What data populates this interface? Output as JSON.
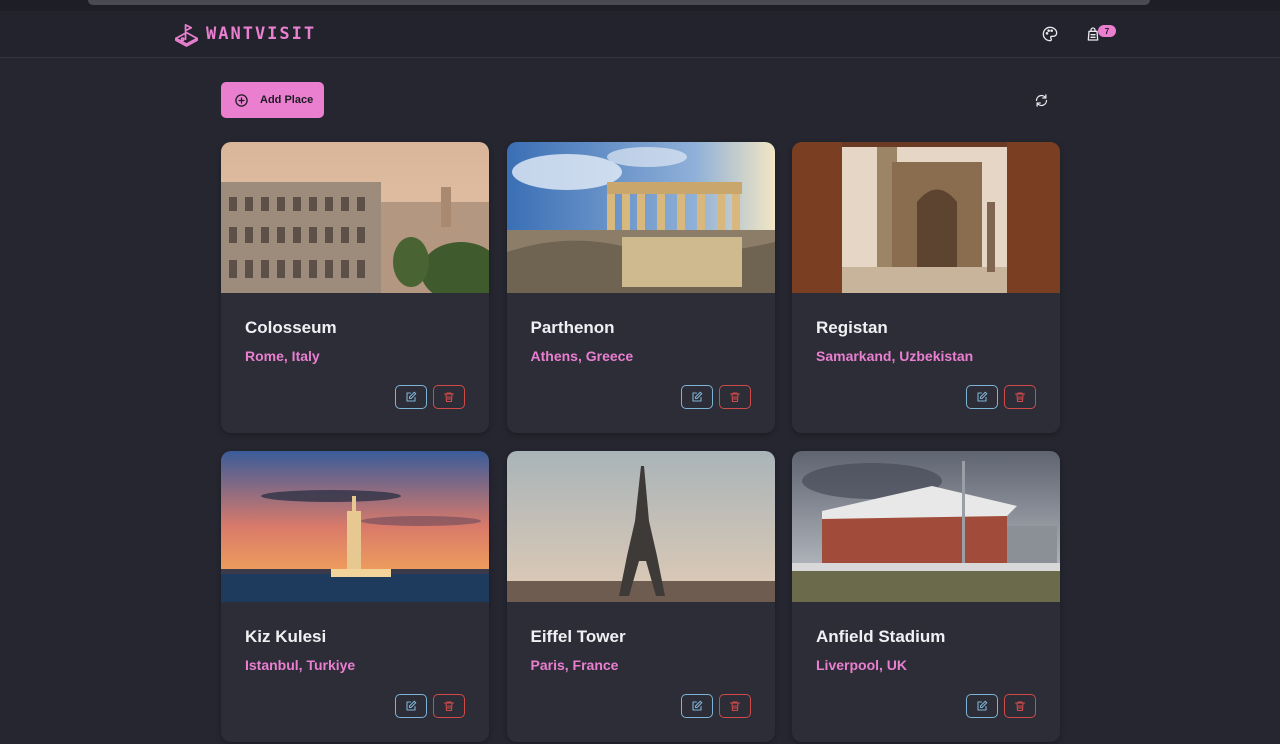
{
  "app": {
    "brand": "WANTVISIT",
    "cart_count": "7"
  },
  "toolbar": {
    "add_label": "Add Place"
  },
  "places": [
    {
      "name": "Colosseum",
      "location": "Rome, Italy"
    },
    {
      "name": "Parthenon",
      "location": "Athens, Greece"
    },
    {
      "name": "Registan",
      "location": "Samarkand, Uzbekistan"
    },
    {
      "name": "Kiz Kulesi",
      "location": "Istanbul, Turkiye"
    },
    {
      "name": "Eiffel Tower",
      "location": "Paris, France"
    },
    {
      "name": "Anfield Stadium",
      "location": "Liverpool, UK"
    }
  ],
  "colors": {
    "accent": "#ea7fd0",
    "background": "#252630",
    "card": "#2c2d37",
    "edit": "#7fb3d6",
    "delete": "#d04a4a"
  },
  "icons": {
    "logo": "map-pin-flag-icon",
    "palette": "palette-icon",
    "cart": "bag-icon",
    "add": "plus-circle-icon",
    "refresh": "refresh-icon",
    "edit": "edit-icon",
    "delete": "trash-icon"
  }
}
